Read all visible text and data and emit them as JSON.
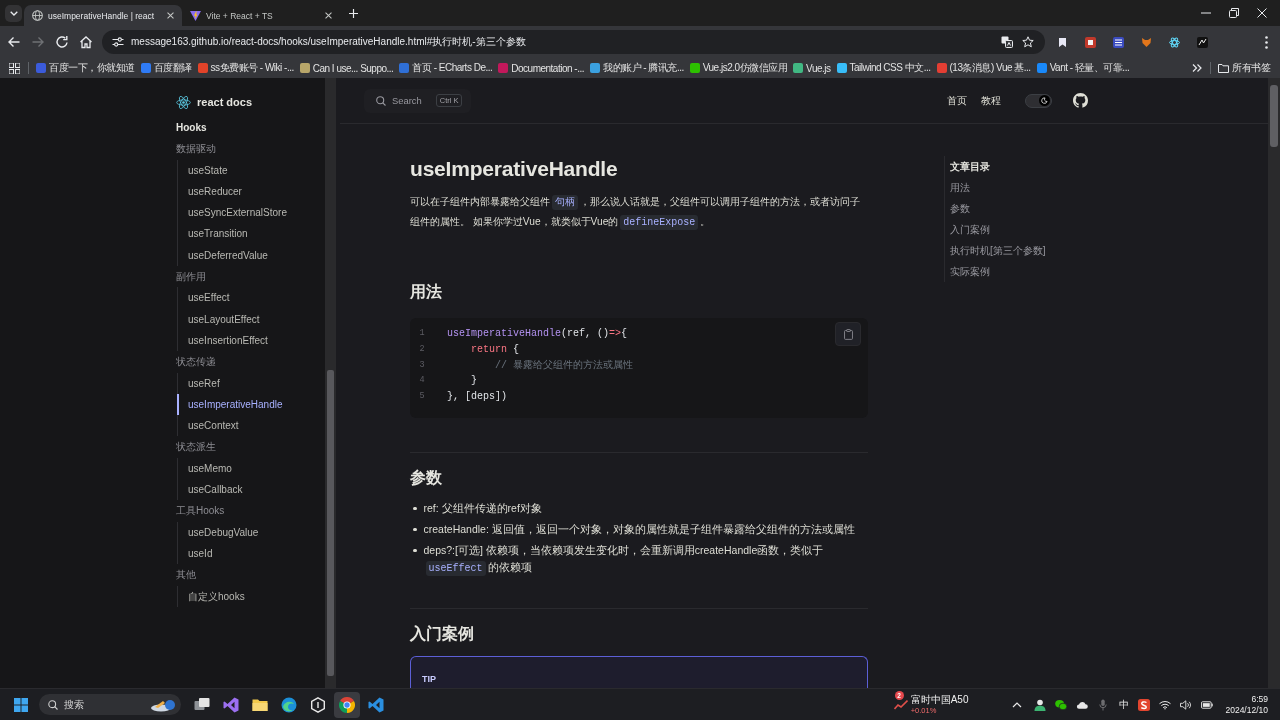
{
  "browser": {
    "tabs": [
      {
        "title": "useImperativeHandle | react",
        "selected": true,
        "kind": "globe"
      },
      {
        "title": "Vite + React + TS",
        "selected": false,
        "kind": "bolt"
      }
    ],
    "forward": {
      "disabled": true
    },
    "address": "message163.github.io/react-docs/hooks/useImperativeHandle.html#执行时机-第三个参数",
    "bookmarks": [
      {
        "label": "百度一下，你就知道",
        "color": "#3b5bdb"
      },
      {
        "label": "百度翻译",
        "color": "#2f7bf5"
      },
      {
        "label": "ss免费账号 - Wiki -...",
        "color": "#e24329"
      },
      {
        "label": "Can I use... Suppo...",
        "color": "#b8a66a"
      },
      {
        "label": "首页 - ECharts De...",
        "color": "#2f6fd6"
      },
      {
        "label": "Documentation -...",
        "color": "#c2185b"
      },
      {
        "label": "我的账户 - 腾讯充...",
        "color": "#3ba1e0"
      },
      {
        "label": "Vue.js2.0仿微信应用",
        "color": "#2dc100"
      },
      {
        "label": "Vue.js",
        "color": "#41b883"
      },
      {
        "label": "Tailwind CSS 中文...",
        "color": "#38bdf8"
      },
      {
        "label": "(13条消息) Vue 基...",
        "color": "#e33e33"
      },
      {
        "label": "Vant - 轻量、可靠...",
        "color": "#1989fa"
      }
    ],
    "all_bookmarks": "所有书签"
  },
  "site": {
    "logo": "react docs",
    "search": {
      "label": "Search",
      "shortcut": "Ctrl K"
    },
    "nav": [
      {
        "label": "首页"
      },
      {
        "label": "教程"
      }
    ],
    "dark_toggle": {
      "on": true
    }
  },
  "sidebar": {
    "title": "Hooks",
    "groups": [
      {
        "label": "数据驱动",
        "children": [
          {
            "label": "useState",
            "selected": false
          },
          {
            "label": "useReducer",
            "selected": false
          },
          {
            "label": "useSyncExternalStore",
            "selected": false
          },
          {
            "label": "useTransition",
            "selected": false
          },
          {
            "label": "useDeferredValue",
            "selected": false
          }
        ]
      },
      {
        "label": "副作用",
        "children": [
          {
            "label": "useEffect",
            "selected": false
          },
          {
            "label": "useLayoutEffect",
            "selected": false
          },
          {
            "label": "useInsertionEffect",
            "selected": false
          }
        ]
      },
      {
        "label": "状态传递",
        "children": [
          {
            "label": "useRef",
            "selected": false
          },
          {
            "label": "useImperativeHandle",
            "selected": true
          },
          {
            "label": "useContext",
            "selected": false
          }
        ]
      },
      {
        "label": "状态派生",
        "children": [
          {
            "label": "useMemo",
            "selected": false
          },
          {
            "label": "useCallback",
            "selected": false
          }
        ]
      },
      {
        "label": "工具Hooks",
        "children": [
          {
            "label": "useDebugValue",
            "selected": false
          },
          {
            "label": "useId",
            "selected": false
          }
        ]
      },
      {
        "label": "其他",
        "children": [
          {
            "label": "自定义hooks",
            "selected": false
          }
        ]
      }
    ]
  },
  "article": {
    "title": "useImperativeHandle",
    "intro": [
      {
        "kind": "text",
        "text": "可以在子组件内部暴露给父组件"
      },
      {
        "kind": "code",
        "text": "句柄"
      },
      {
        "kind": "text",
        "text": "，那么说人话就是，父组件可以调用子组件的方法，或者访问子组件的属性。 如果你学过Vue，就类似于Vue的"
      },
      {
        "kind": "code",
        "text": "defineExpose"
      },
      {
        "kind": "text",
        "text": "。"
      }
    ],
    "sections": [
      {
        "kind": "code",
        "heading": "用法",
        "lines": [
          {
            "n": "1",
            "tokens": [
              {
                "kind": "fn",
                "text": "useImperativeHandle"
              },
              {
                "kind": "plain",
                "text": "(ref, ()"
              },
              {
                "kind": "op",
                "text": "=>"
              },
              {
                "kind": "plain",
                "text": "{"
              }
            ]
          },
          {
            "n": "2",
            "tokens": [
              {
                "kind": "keyword",
                "text": "    return"
              },
              {
                "kind": "plain",
                "text": " {"
              }
            ]
          },
          {
            "n": "3",
            "tokens": [
              {
                "kind": "comment",
                "text": "        // 暴露给父组件的方法或属性"
              }
            ]
          },
          {
            "n": "4",
            "tokens": [
              {
                "kind": "plain",
                "text": "    }"
              }
            ]
          },
          {
            "n": "5",
            "tokens": [
              {
                "kind": "plain",
                "text": "}, [deps])"
              }
            ]
          }
        ]
      },
      {
        "kind": "list",
        "heading": "参数",
        "items": [
          [
            {
              "kind": "text",
              "text": "ref: 父组件传递的ref对象"
            }
          ],
          [
            {
              "kind": "text",
              "text": "createHandle: 返回值，返回一个对象，对象的属性就是子组件暴露给父组件的方法或属性"
            }
          ],
          [
            {
              "kind": "text",
              "text": "deps?:[可选] 依赖项，当依赖项发生变化时，会重新调用createHandle函数，类似于"
            },
            {
              "kind": "code",
              "text": "useEffect"
            },
            {
              "kind": "text",
              "text": "的依赖项"
            }
          ]
        ]
      },
      {
        "kind": "tip",
        "heading": "入门案例",
        "tip": "TIP"
      }
    ]
  },
  "toc": {
    "title": "文章目录",
    "items": [
      {
        "label": "用法",
        "selected": false
      },
      {
        "label": "参数",
        "selected": false
      },
      {
        "label": "入门案例",
        "selected": false
      },
      {
        "label": "执行时机[第三个参数]",
        "selected": false
      },
      {
        "label": "实际案例",
        "selected": false
      }
    ]
  },
  "taskbar": {
    "search": {
      "placeholder": "搜索"
    },
    "apps": [
      {
        "kind": "task-view",
        "selected": false
      },
      {
        "kind": "ribbon-purple",
        "selected": false
      },
      {
        "kind": "folder",
        "selected": false
      },
      {
        "kind": "wave",
        "selected": false
      },
      {
        "kind": "hexagon",
        "selected": false
      },
      {
        "kind": "segmented",
        "selected": true
      },
      {
        "kind": "ribbon-blue",
        "selected": false
      }
    ],
    "widget": {
      "badge": "2",
      "name": "富时中国A50",
      "change": "+0.01%"
    },
    "ime": "中",
    "clock": {
      "time": "6:59",
      "date": "2024/12/10"
    }
  }
}
